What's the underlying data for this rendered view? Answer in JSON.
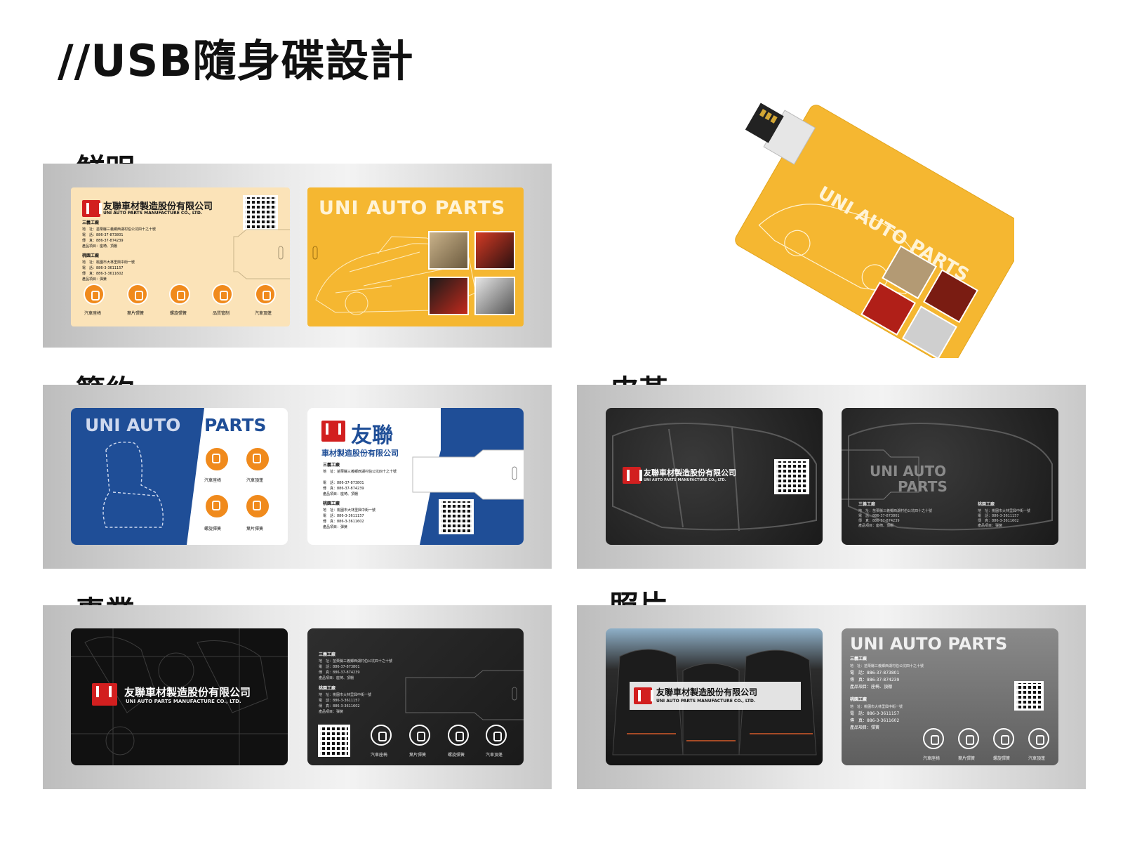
{
  "page": {
    "title": "//USB隨身碟設計"
  },
  "sections": {
    "vivid": "鮮明",
    "simple": "簡約",
    "leather": "皮革",
    "professional": "專業",
    "photo": "照片"
  },
  "company": {
    "name_zh": "友聯車材製造股份有限公司",
    "name_en": "UNI AUTO PARTS MANUFACTURE CO., LTD.",
    "brand": "UNI AUTO PARTS",
    "brand_zh": "友聯",
    "sub_zh": "車材製造股份有限公司",
    "uni_auto": "UNI AUTO",
    "parts": "PARTS"
  },
  "factory1": {
    "title": "三義工廠",
    "addr": "地　址：苗栗縣三義鄉西湖村伯公坑四十之十號",
    "tel": "電　話：886-37-873801",
    "fax": "傳　真：886-37-874239",
    "items": "產品項目：座椅、頂棚"
  },
  "factory2": {
    "title": "桃園工廠",
    "addr": "地　址：桃園市大林里興中街一號",
    "tel": "電　話：886-3-3611157",
    "fax": "傳　真：886-3-3611602",
    "items": "產品項目：彈簧"
  },
  "products": {
    "seat": "汽車座椅",
    "leaf": "葉片彈簧",
    "coil": "螺旋彈簧",
    "qc": "品質管制",
    "roof": "汽車頂蓬"
  },
  "colors": {
    "orange": "#f5b731",
    "cream": "#fbe3b8",
    "blue": "#1f4e97",
    "dark": "#222222",
    "red": "#d21f1f"
  }
}
